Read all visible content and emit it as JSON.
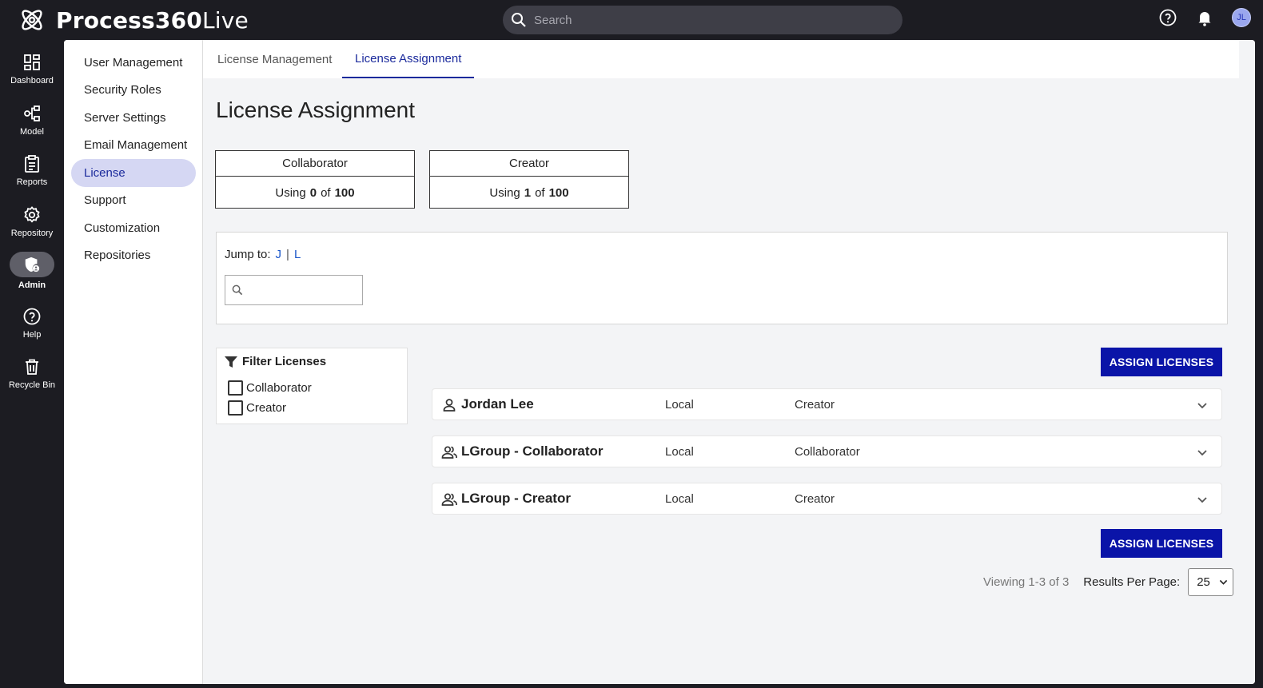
{
  "app": {
    "name_bold": "Process360",
    "name_light": "Live"
  },
  "search": {
    "placeholder": "Search"
  },
  "user": {
    "initials": "JL"
  },
  "rail": {
    "items": [
      {
        "label": "Dashboard",
        "icon": "dashboard-icon"
      },
      {
        "label": "Model",
        "icon": "model-icon"
      },
      {
        "label": "Reports",
        "icon": "reports-icon"
      },
      {
        "label": "Repository",
        "icon": "repository-gear-icon"
      },
      {
        "label": "Admin",
        "icon": "admin-shield-icon",
        "active": true
      },
      {
        "label": "Help",
        "icon": "help-icon"
      },
      {
        "label": "Recycle Bin",
        "icon": "trash-icon"
      }
    ]
  },
  "subnav": {
    "items": [
      {
        "label": "User Management"
      },
      {
        "label": "Security Roles"
      },
      {
        "label": "Server Settings"
      },
      {
        "label": "Email Management"
      },
      {
        "label": "License",
        "active": true
      },
      {
        "label": "Support"
      },
      {
        "label": "Customization"
      },
      {
        "label": "Repositories"
      }
    ]
  },
  "tabs": [
    {
      "label": "License Management"
    },
    {
      "label": "License Assignment",
      "active": true
    }
  ],
  "page": {
    "title": "License Assignment"
  },
  "licenses": [
    {
      "name": "Collaborator",
      "using_label": "Using",
      "used": "0",
      "of_label": "of",
      "total": "100"
    },
    {
      "name": "Creator",
      "using_label": "Using",
      "used": "1",
      "of_label": "of",
      "total": "100"
    }
  ],
  "jump": {
    "label": "Jump to:",
    "letters": [
      "J",
      "L"
    ],
    "separator": "|"
  },
  "filter": {
    "title": "Filter Licenses",
    "options": [
      {
        "label": "Collaborator",
        "checked": false
      },
      {
        "label": "Creator",
        "checked": false
      }
    ]
  },
  "actions": {
    "assign_label": "ASSIGN LICENSES"
  },
  "rows": [
    {
      "name": "Jordan Lee",
      "type": "Local",
      "license": "Creator",
      "kind": "user"
    },
    {
      "name": "LGroup - Collaborator",
      "type": "Local",
      "license": "Collaborator",
      "kind": "group"
    },
    {
      "name": "LGroup - Creator",
      "type": "Local",
      "license": "Creator",
      "kind": "group"
    }
  ],
  "pager": {
    "viewing": "Viewing 1-3 of 3",
    "rpp_label": "Results Per Page:",
    "rpp_value": "25"
  },
  "colors": {
    "accent": "#0a14a8",
    "active_nav_bg": "#d5d7f3",
    "topbar_bg": "#1c1c22",
    "link": "#1b56c9"
  }
}
